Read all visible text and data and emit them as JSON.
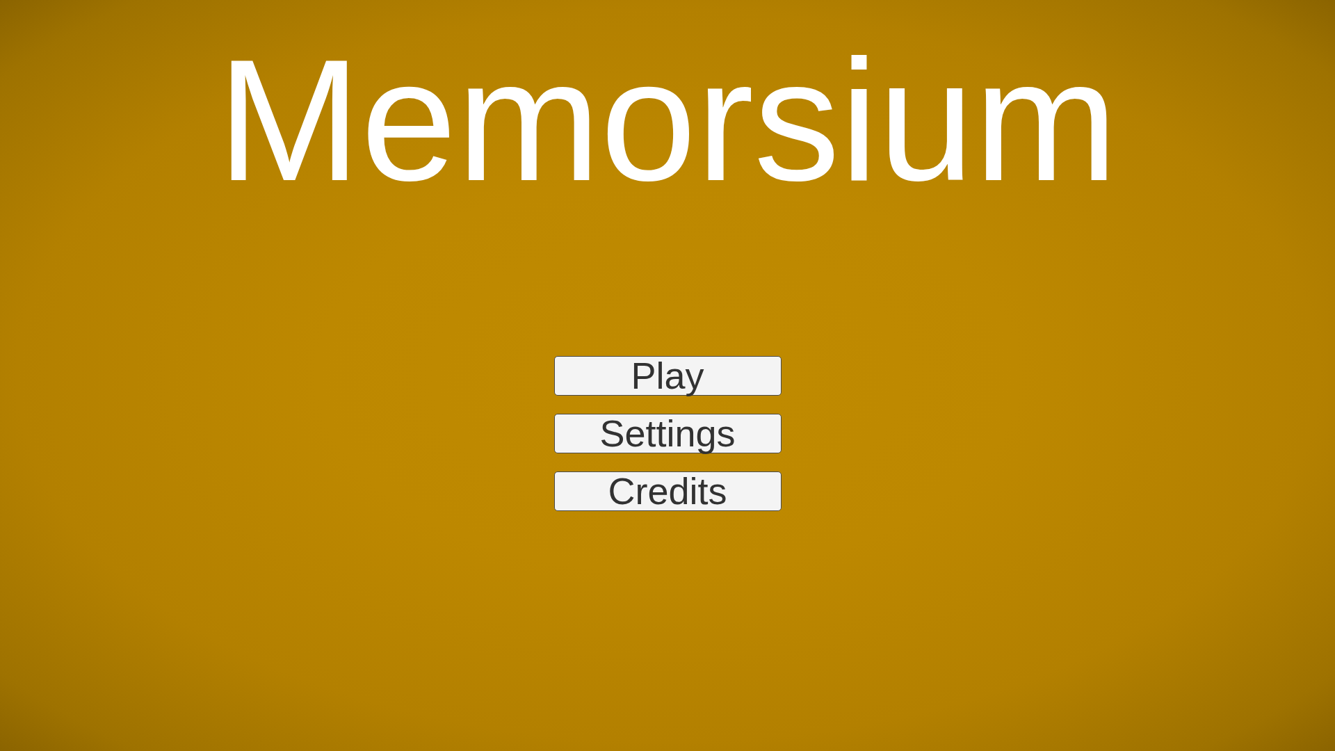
{
  "title": "Memorsium",
  "menu": [
    {
      "label": "Play"
    },
    {
      "label": "Settings"
    },
    {
      "label": "Credits"
    }
  ]
}
